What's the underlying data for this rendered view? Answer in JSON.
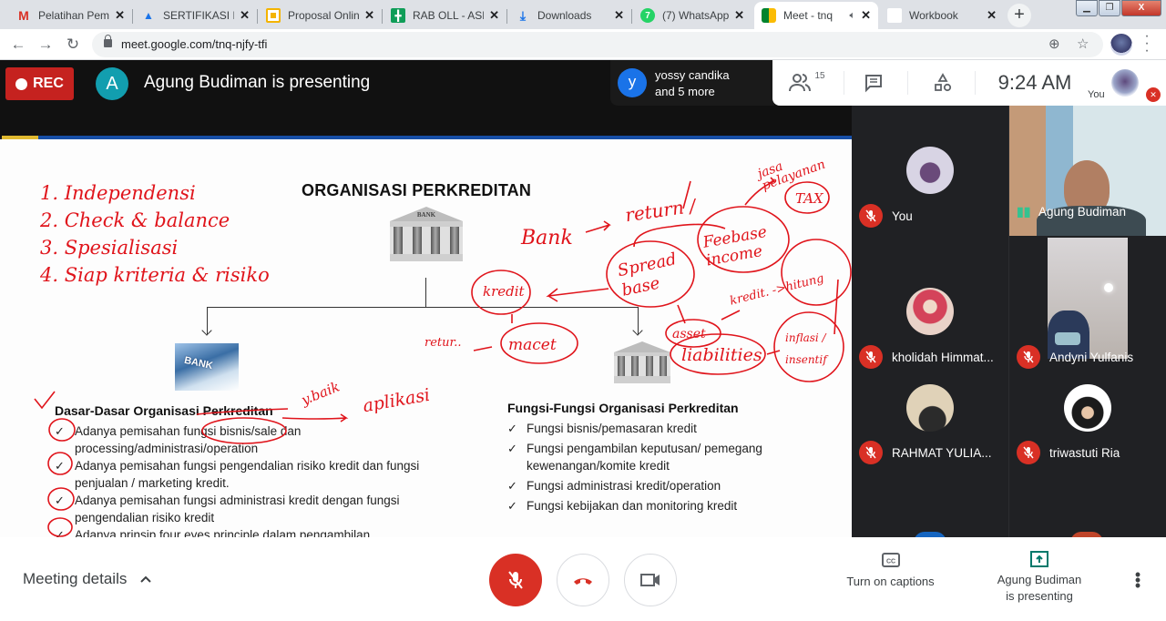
{
  "browser": {
    "tabs": [
      {
        "label": "Pelatihan Pemb",
        "icon": "gmail-icon",
        "fav_color": "#d93025",
        "fav_glyph": "M"
      },
      {
        "label": "SERTIFIKASI MR",
        "icon": "google-drive-icon",
        "fav_color": "#1a73e8",
        "fav_glyph": "▲"
      },
      {
        "label": "Proposal Online",
        "icon": "google-slides-icon",
        "fav_color": "#f4b400",
        "fav_glyph": "▭"
      },
      {
        "label": "RAB OLL - ASKR",
        "icon": "google-sheets-icon",
        "fav_color": "#0f9d58",
        "fav_glyph": "╋"
      },
      {
        "label": "Downloads",
        "icon": "download-icon",
        "fav_color": "#1a73e8",
        "fav_glyph": "⤓"
      },
      {
        "label": "(7) WhatsApp",
        "icon": "whatsapp-icon",
        "fav_color": "#25d366",
        "fav_glyph": "7"
      },
      {
        "label": "Meet - tnq",
        "icon": "google-meet-icon",
        "fav_color": "#00832d",
        "fav_glyph": "▶",
        "active": true,
        "audio": true
      },
      {
        "label": "Workbook",
        "icon": "blank-page-icon",
        "fav_color": "#ffffff",
        "fav_glyph": ""
      }
    ],
    "url": "meet.google.com/tnq-njfy-tfi"
  },
  "meet_header": {
    "rec_label": "REC",
    "presenter_initial": "A",
    "presenting_text": "Agung Budiman is presenting",
    "speaker_initial": "y",
    "speaker_line1": "yossy candika",
    "speaker_line2": "and 5 more",
    "participant_count": "15",
    "time": "9:24  AM",
    "self_label": "You"
  },
  "slide": {
    "title": "ORGANISASI PERKREDITAN",
    "bank_label": "BANK",
    "photo_label": "BANK",
    "left_heading": "Dasar-Dasar Organisasi Perkreditan",
    "left_items": [
      "Adanya pemisahan fungsi bisnis/sale dan processing/administrasi/operation",
      "Adanya pemisahan fungsi pengendalian risiko kredit dan fungsi penjualan / marketing kredit.",
      "Adanya pemisahan fungsi administrasi kredit dengan fungsi pengendalian risiko kredit",
      "Adanya prinsip four eyes principle dalam pengambilan..."
    ],
    "right_heading": "Fungsi-Fungsi Organisasi Perkreditan",
    "right_items": [
      "Fungsi bisnis/pemasaran kredit",
      "Fungsi pengambilan keputusan/ pemegang kewenangan/komite kredit",
      "Fungsi administrasi kredit/operation",
      "Fungsi kebijakan dan monitoring kredit"
    ],
    "annotations": {
      "list": [
        "1. Independensi",
        "2. Check & balance",
        "3. Spesialisasi",
        "4. Siap kriteria & risiko"
      ],
      "bank": "Bank",
      "return": "return /",
      "jasa": "jasa pelayanan",
      "fee": "Feebase income",
      "tax": "TAX",
      "kredit": "kredit",
      "spread": "Spread base",
      "macet": "macet",
      "retur": "retur..",
      "asset": "asset",
      "liabilities": "liabilities",
      "kredit2": "kredit. ->hitung",
      "inflasi": "inflasi / insentif",
      "ybaik": "y.baik",
      "aplikasi": "aplikasi"
    }
  },
  "participants": [
    {
      "name": "You",
      "muted": true,
      "type": "avatar",
      "avatar_colors": [
        "#d8d4e4",
        "#6a4a7a"
      ]
    },
    {
      "name": "Agung Budiman",
      "muted": false,
      "speaking": true,
      "type": "video"
    },
    {
      "name": "kholidah Himmat...",
      "muted": true,
      "type": "avatar",
      "avatar_colors": [
        "#e9d2c8",
        "#d4435a"
      ]
    },
    {
      "name": "Andyni Yulfanis",
      "muted": true,
      "type": "video"
    },
    {
      "name": "RAHMAT YULIA...",
      "muted": true,
      "type": "avatar",
      "avatar_colors": [
        "#e0d2b8",
        "#2b2b2b"
      ]
    },
    {
      "name": "triwastuti Ria",
      "muted": true,
      "type": "avatar",
      "avatar_colors": [
        "#ffffff",
        "#1b1b1b"
      ]
    }
  ],
  "bottom": {
    "meeting_details": "Meeting details",
    "captions_label": "Turn on captions",
    "presenting_line1": "Agung Budiman",
    "presenting_line2": "is presenting"
  },
  "colors": {
    "rec": "#c5221f",
    "mute_red": "#d93025",
    "presenter_teal": "#129eaf",
    "annotation_red": "#e0141b",
    "present_green": "#00796b"
  }
}
